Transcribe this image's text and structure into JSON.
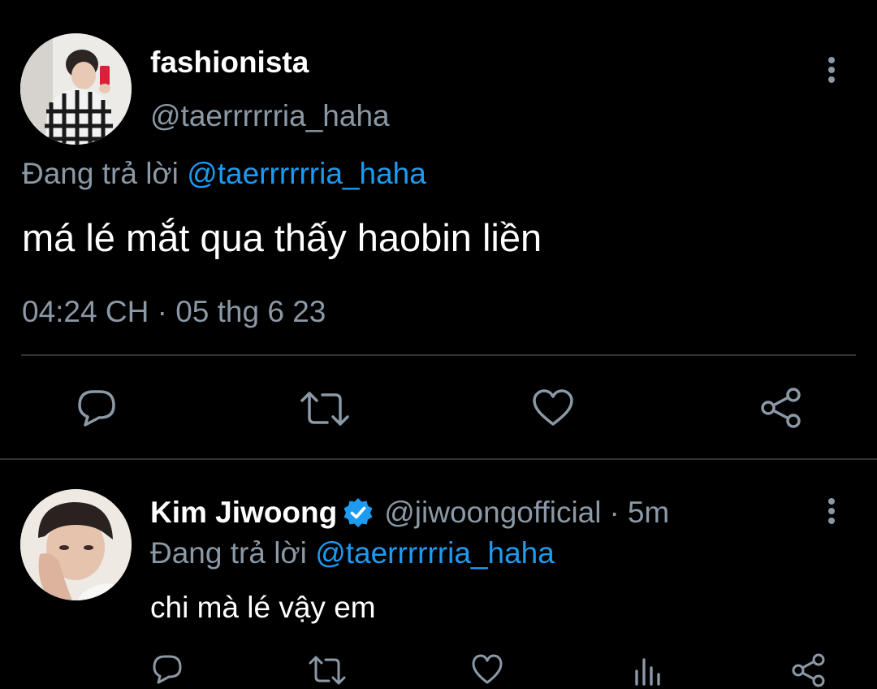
{
  "colors": {
    "background": "#000000",
    "text": "#ffffff",
    "muted": "#8b98a5",
    "link": "#1d9bf0",
    "divider": "#2f3336"
  },
  "main_tweet": {
    "display_name": "fashionista",
    "handle": "@taerrrrrria_haha",
    "reply_prefix": "Đang trả lời",
    "reply_to": "@taerrrrrria_haha",
    "text": "má lé mắt qua thấy haobin liền",
    "timestamp": "04:24 CH · 05 thg 6 23",
    "actions": [
      "reply-icon",
      "retweet-icon",
      "like-icon",
      "share-icon"
    ]
  },
  "reply_tweet": {
    "display_name": "Kim Jiwoong",
    "verified": true,
    "handle": "@jiwoongofficial",
    "separator": "·",
    "time": "5m",
    "reply_prefix": "Đang trả lời",
    "reply_to": "@taerrrrrria_haha",
    "text": "chi mà lé vậy em",
    "actions": [
      "reply-icon",
      "retweet-icon",
      "like-icon",
      "analytics-icon",
      "share-icon"
    ]
  }
}
